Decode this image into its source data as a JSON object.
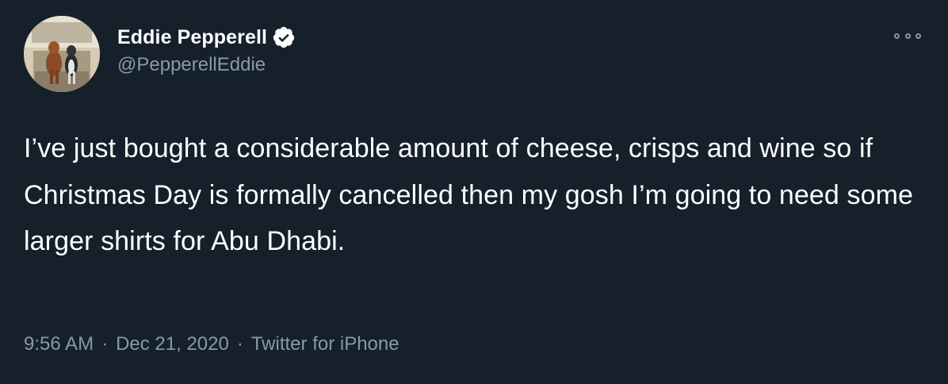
{
  "tweet": {
    "display_name": "Eddie Pepperell",
    "handle": "@PepperellEddie",
    "verified": true,
    "text": "I’ve just bought a considerable amount of cheese, crisps and wine so if Christmas Day is formally cancelled then my gosh I’m going to need some larger shirts for Abu Dhabi.",
    "time": "9:56 AM",
    "separator": "·",
    "date": "Dec 21, 2020",
    "source": "Twitter for iPhone"
  },
  "icons": {
    "verified": "verified-badge-icon",
    "more": "more-options-icon"
  },
  "colors": {
    "background": "#15202b",
    "primary_text": "#ffffff",
    "secondary_text": "#8899a6"
  }
}
